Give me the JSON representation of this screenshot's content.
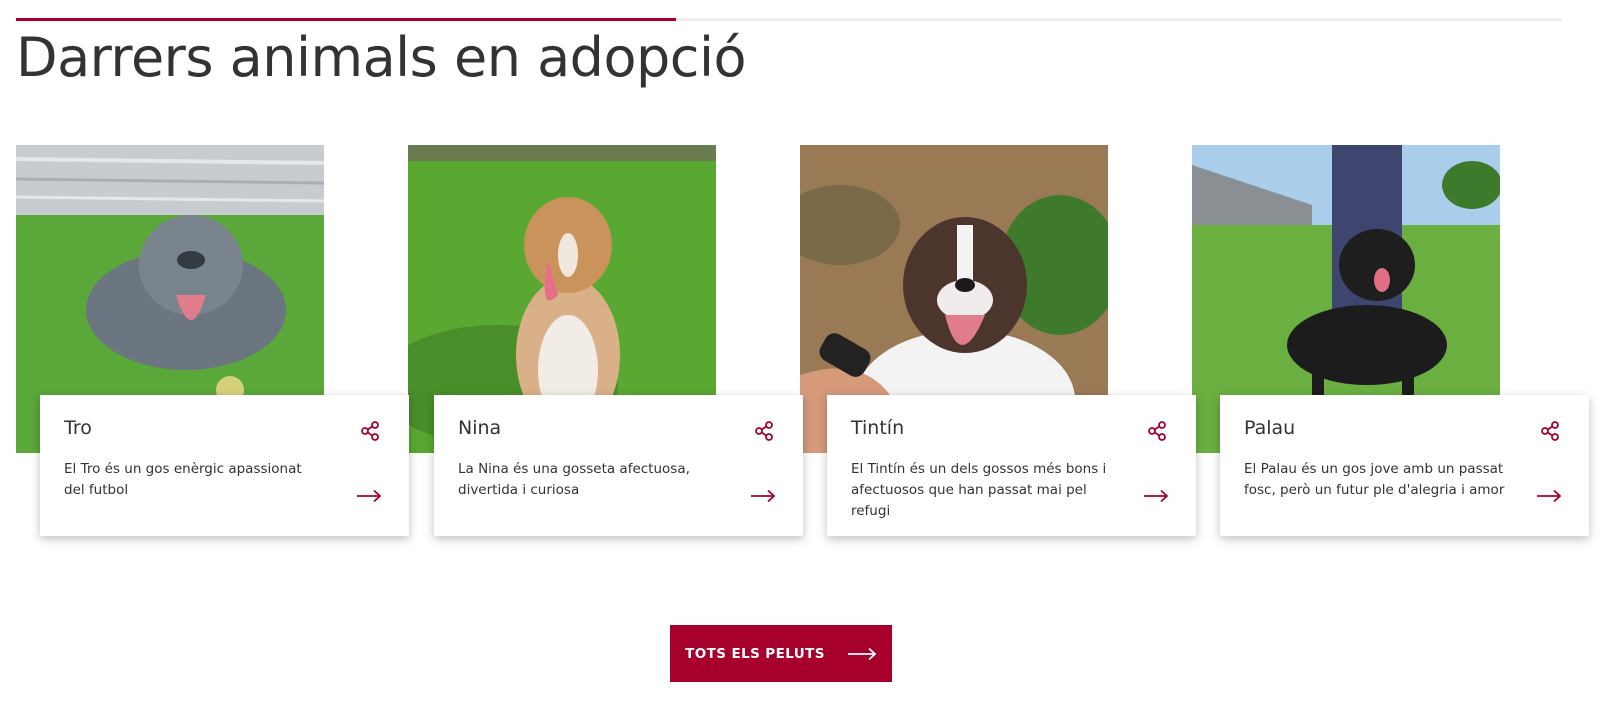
{
  "section": {
    "title": "Darrers animals en adopció"
  },
  "animals": [
    {
      "name": "Tro",
      "description": "El Tro és un gos enèrgic apassionat del futbol",
      "photo_icon": "grey-dog-on-grass-photo"
    },
    {
      "name": "Nina",
      "description": "La Nina és una gosseta afectuosa, divertida i curiosa",
      "photo_icon": "tan-dog-on-grass-photo"
    },
    {
      "name": "Tintín",
      "description": "El Tintín és un dels gossos més bons i afectuosos que han passat mai pel refugi",
      "photo_icon": "brown-white-dog-photo"
    },
    {
      "name": "Palau",
      "description": "El Palau és un gos jove amb un passat fosc, però un futur ple d'alegria i amor",
      "photo_icon": "black-dog-on-grass-photo"
    }
  ],
  "cta": {
    "label": "TOTS ELS PELUTS"
  },
  "colors": {
    "accent": "#a8002c",
    "text": "#333333",
    "track": "#eeeeee"
  }
}
